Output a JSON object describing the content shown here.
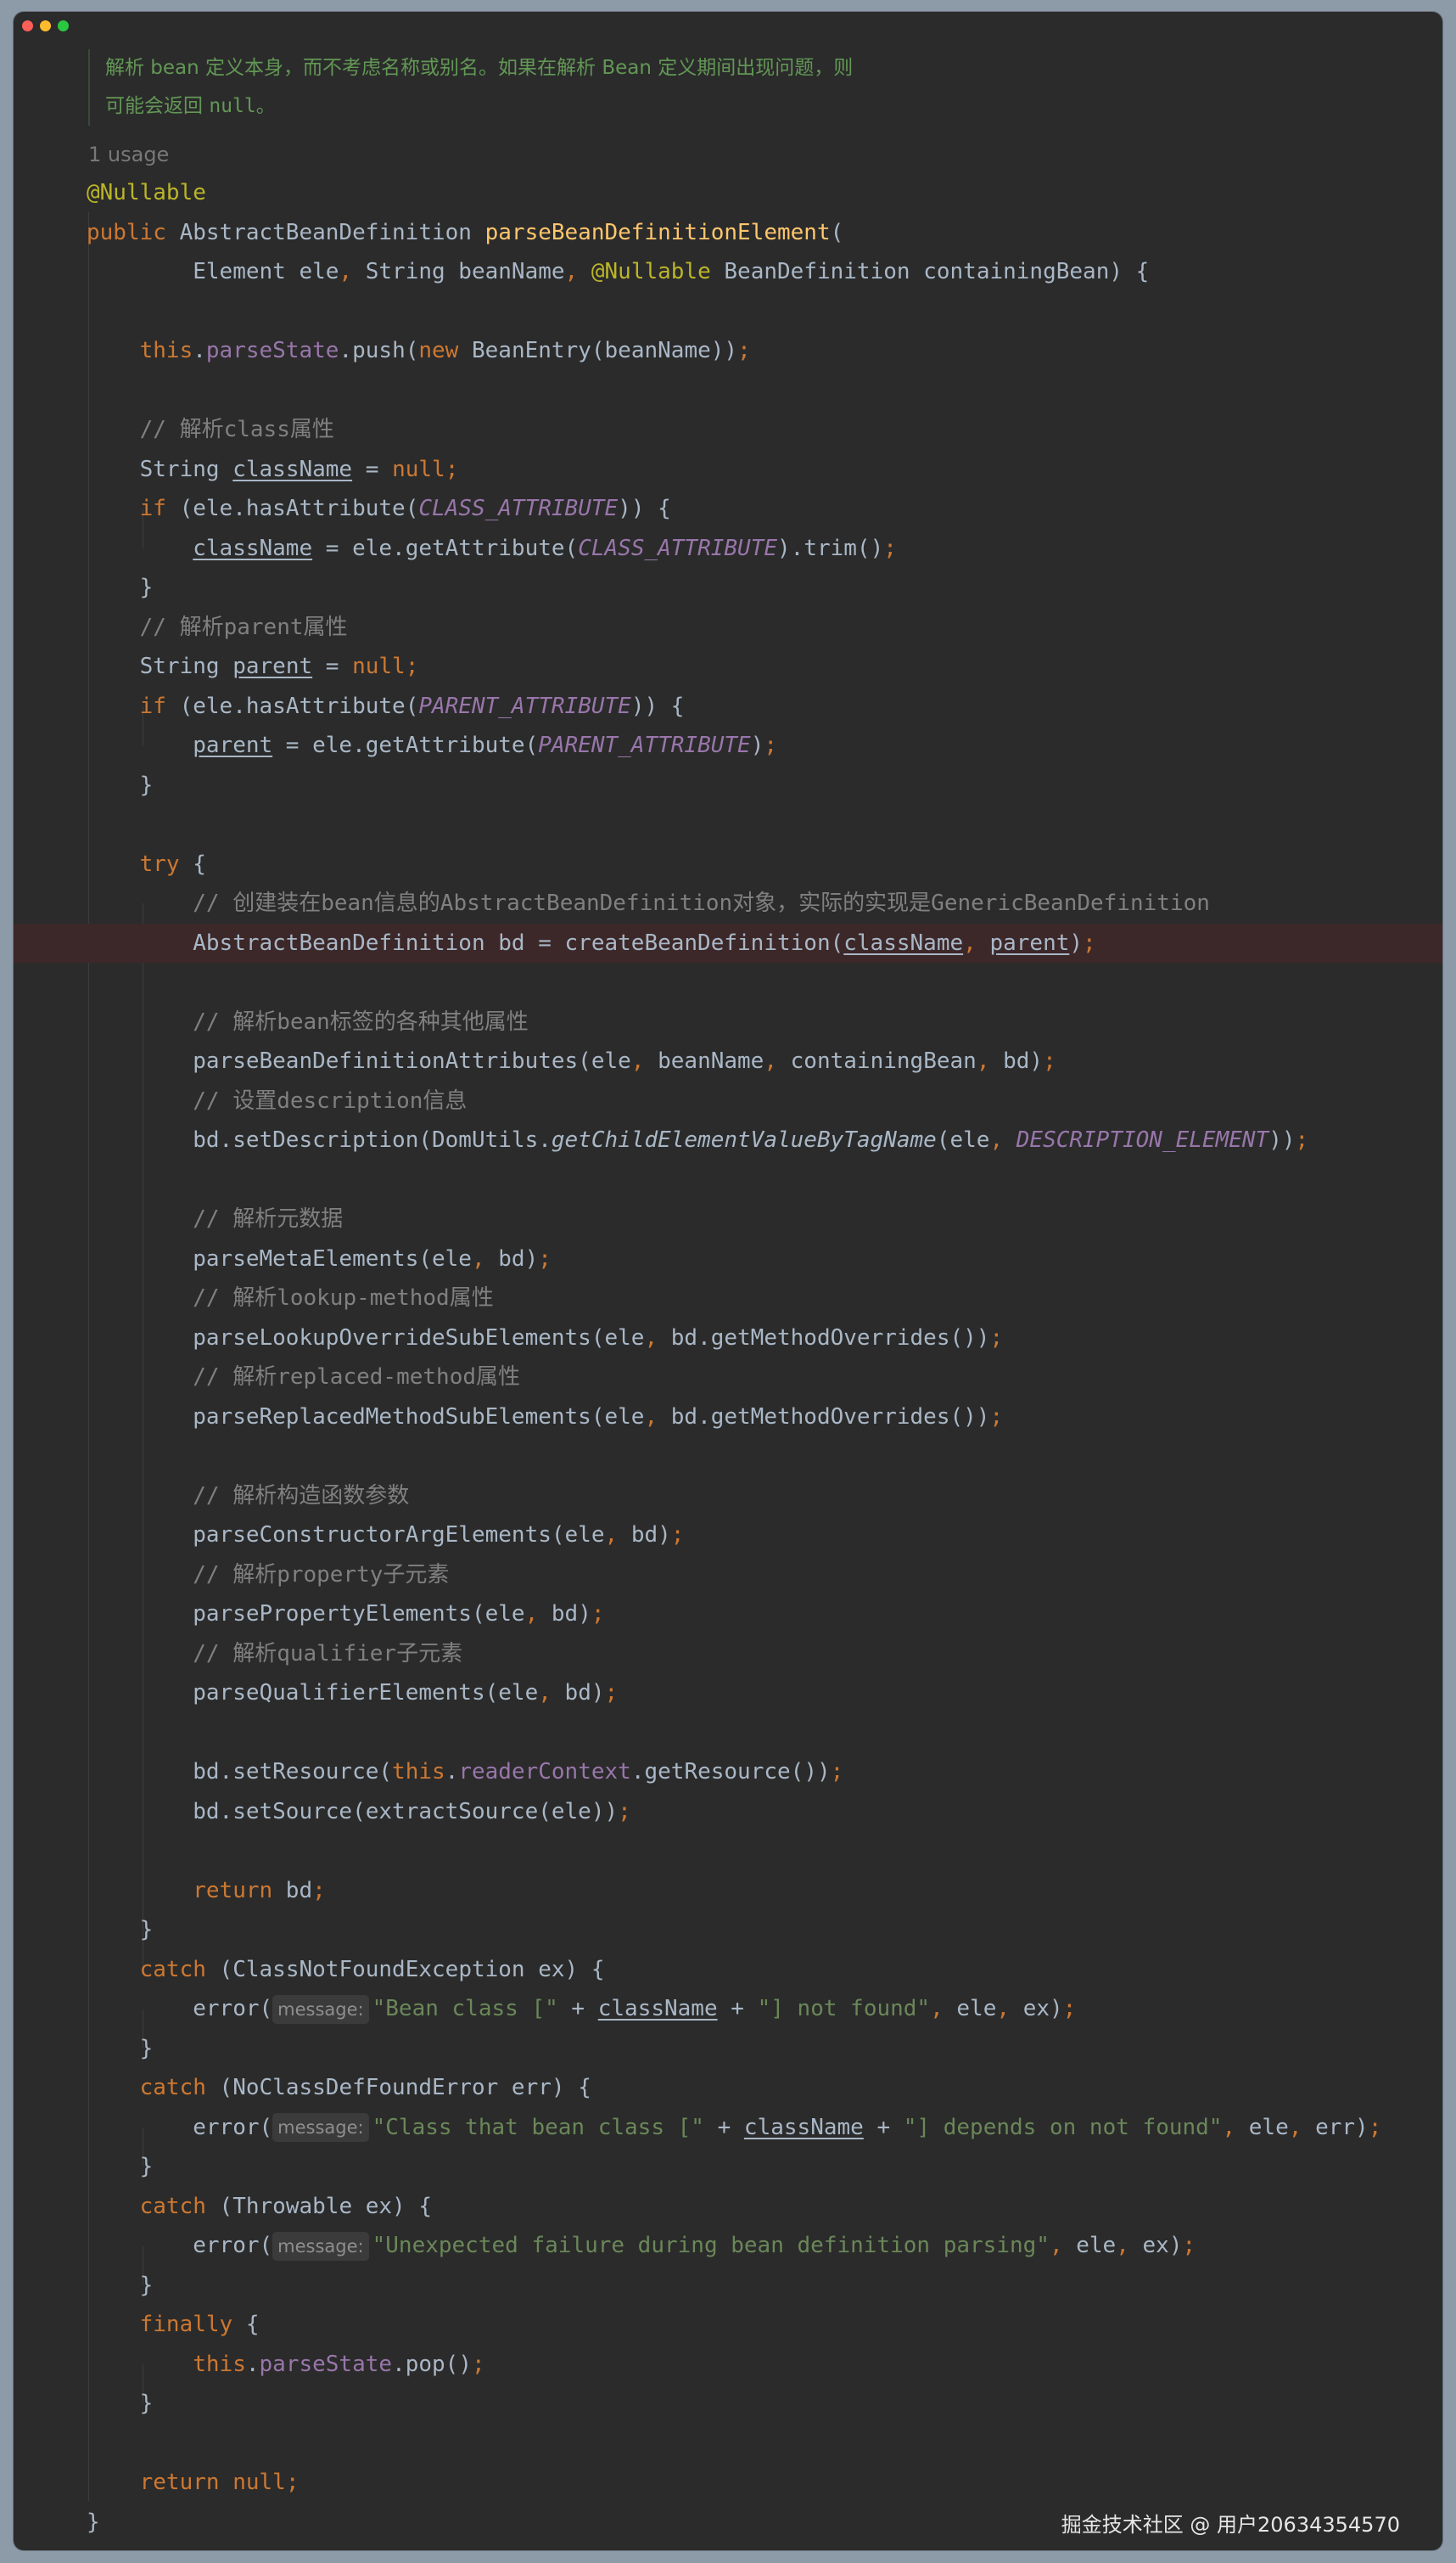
{
  "doc": {
    "line1": "解析 bean 定义本身，而不考虑名称或别名。如果在解析 Bean 定义期间出现问题，则",
    "line2_text": "可能会返回 ",
    "line2_code": "null",
    "line2_end": "。"
  },
  "usage": "1 usage",
  "hint_label": "message:",
  "code": {
    "l1_ann": "@Nullable",
    "l2_kw": "public",
    "l2_type": " AbstractBeanDefinition ",
    "l2_fn": "parseBeanDefinitionElement",
    "l2_paren": "(",
    "l3_a": "Element ele",
    "l3_b": ", ",
    "l3_c": "String beanName",
    "l3_d": ", ",
    "l3_ann": "@Nullable",
    "l3_e": " BeanDefinition containingBean) {",
    "l5_this": "this",
    "l5_a": ".",
    "l5_fld": "parseState",
    "l5_b": ".push(",
    "l5_new": "new",
    "l5_c": " BeanEntry(beanName))",
    "l5_semi": ";",
    "l7_cm": "// 解析class属性",
    "l8_a": "String ",
    "l8_var": "className",
    "l8_b": " = ",
    "l8_null": "null",
    "l8_semi": ";",
    "l9_if": "if",
    "l9_a": " (ele.hasAttribute(",
    "l9_const": "CLASS_ATTRIBUTE",
    "l9_b": ")) {",
    "l10_var": "className",
    "l10_a": " = ele.getAttribute(",
    "l10_const": "CLASS_ATTRIBUTE",
    "l10_b": ").trim()",
    "l10_semi": ";",
    "l11": "}",
    "l12_cm": "// 解析parent属性",
    "l13_a": "String ",
    "l13_var": "parent",
    "l13_b": " = ",
    "l13_null": "null",
    "l13_semi": ";",
    "l14_if": "if",
    "l14_a": " (ele.hasAttribute(",
    "l14_const": "PARENT_ATTRIBUTE",
    "l14_b": ")) {",
    "l15_var": "parent",
    "l15_a": " = ele.getAttribute(",
    "l15_const": "PARENT_ATTRIBUTE",
    "l15_b": ")",
    "l15_semi": ";",
    "l16": "}",
    "l18_try": "try",
    "l18_a": " {",
    "l19_cm": "// 创建装在bean信息的AbstractBeanDefinition对象，实际的实现是GenericBeanDefinition",
    "l20_a": "AbstractBeanDefinition bd = createBeanDefinition(",
    "l20_v1": "className",
    "l20_b": ", ",
    "l20_v2": "parent",
    "l20_c": ")",
    "l20_semi": ";",
    "l22_cm": "// 解析bean标签的各种其他属性",
    "l23_a": "parseBeanDefinitionAttributes(ele",
    "l23_c1": ", ",
    "l23_b": "beanName",
    "l23_c2": ", ",
    "l23_c": "containingBean",
    "l23_c3": ", ",
    "l23_d": "bd)",
    "l23_semi": ";",
    "l24_cm": "// 设置description信息",
    "l25_a": "bd.setDescription(DomUtils.",
    "l25_it": "getChildElementValueByTagName",
    "l25_b": "(ele",
    "l25_c": ", ",
    "l25_const": "DESCRIPTION_ELEMENT",
    "l25_d": "))",
    "l25_semi": ";",
    "l27_cm": "// 解析元数据",
    "l28_a": "parseMetaElements(ele",
    "l28_c": ", ",
    "l28_b": "bd)",
    "l28_semi": ";",
    "l29_cm": "// 解析lookup-method属性",
    "l30_a": "parseLookupOverrideSubElements(ele",
    "l30_c": ", ",
    "l30_b": "bd.getMethodOverrides())",
    "l30_semi": ";",
    "l31_cm": "// 解析replaced-method属性",
    "l32_a": "parseReplacedMethodSubElements(ele",
    "l32_c": ", ",
    "l32_b": "bd.getMethodOverrides())",
    "l32_semi": ";",
    "l34_cm": "// 解析构造函数参数",
    "l35_a": "parseConstructorArgElements(ele",
    "l35_c": ", ",
    "l35_b": "bd)",
    "l35_semi": ";",
    "l36_cm": "// 解析property子元素",
    "l37_a": "parsePropertyElements(ele",
    "l37_c": ", ",
    "l37_b": "bd)",
    "l37_semi": ";",
    "l38_cm": "// 解析qualifier子元素",
    "l39_a": "parseQualifierElements(ele",
    "l39_c": ", ",
    "l39_b": "bd)",
    "l39_semi": ";",
    "l41_a": "bd.setResource(",
    "l41_this": "this",
    "l41_b": ".",
    "l41_fld": "readerContext",
    "l41_c": ".getResource())",
    "l41_semi": ";",
    "l42_a": "bd.setSource(extractSource(ele))",
    "l42_semi": ";",
    "l44_ret": "return",
    "l44_a": " bd",
    "l44_semi": ";",
    "l45": "}",
    "l46_catch": "catch",
    "l46_a": " (ClassNotFoundException ex) {",
    "l47_a": "error(",
    "l47_s1": "\"Bean class [\"",
    "l47_b": " + ",
    "l47_var": "className",
    "l47_c": " + ",
    "l47_s2": "\"] not found\"",
    "l47_d1": ", ",
    "l47_d": "ele",
    "l47_d2": ", ",
    "l47_e": "ex)",
    "l47_semi": ";",
    "l48": "}",
    "l49_catch": "catch",
    "l49_a": " (NoClassDefFoundError err) {",
    "l50_a": "error(",
    "l50_s1": "\"Class that bean class [\"",
    "l50_b": " + ",
    "l50_var": "className",
    "l50_c": " + ",
    "l50_s2": "\"] depends on not found\"",
    "l50_d1": ", ",
    "l50_d": "ele",
    "l50_d2": ", ",
    "l50_e": "err)",
    "l50_semi": ";",
    "l51": "}",
    "l52_catch": "catch",
    "l52_a": " (Throwable ex) {",
    "l53_a": "error(",
    "l53_s1": "\"Unexpected failure during bean definition parsing\"",
    "l53_d1": ", ",
    "l53_d": "ele",
    "l53_d2": ", ",
    "l53_e": "ex)",
    "l53_semi": ";",
    "l54": "}",
    "l55_finally": "finally",
    "l55_a": " {",
    "l56_this": "this",
    "l56_a": ".",
    "l56_fld": "parseState",
    "l56_b": ".pop()",
    "l56_semi": ";",
    "l57": "}",
    "l59_ret": "return",
    "l59_sp": " ",
    "l59_null": "null",
    "l59_semi": ";",
    "l60": "}"
  },
  "watermark": "掘金技术社区 @ 用户20634354570",
  "colors": {
    "background": "#2b2b2b",
    "keyword": "#cc7832",
    "function": "#ffc66d",
    "annotation": "#bbb529",
    "field": "#9876aa",
    "string": "#6a8759",
    "comment": "#808080",
    "doc": "#629755",
    "text": "#a9b7c6",
    "highlight_line": "#3c2829"
  }
}
